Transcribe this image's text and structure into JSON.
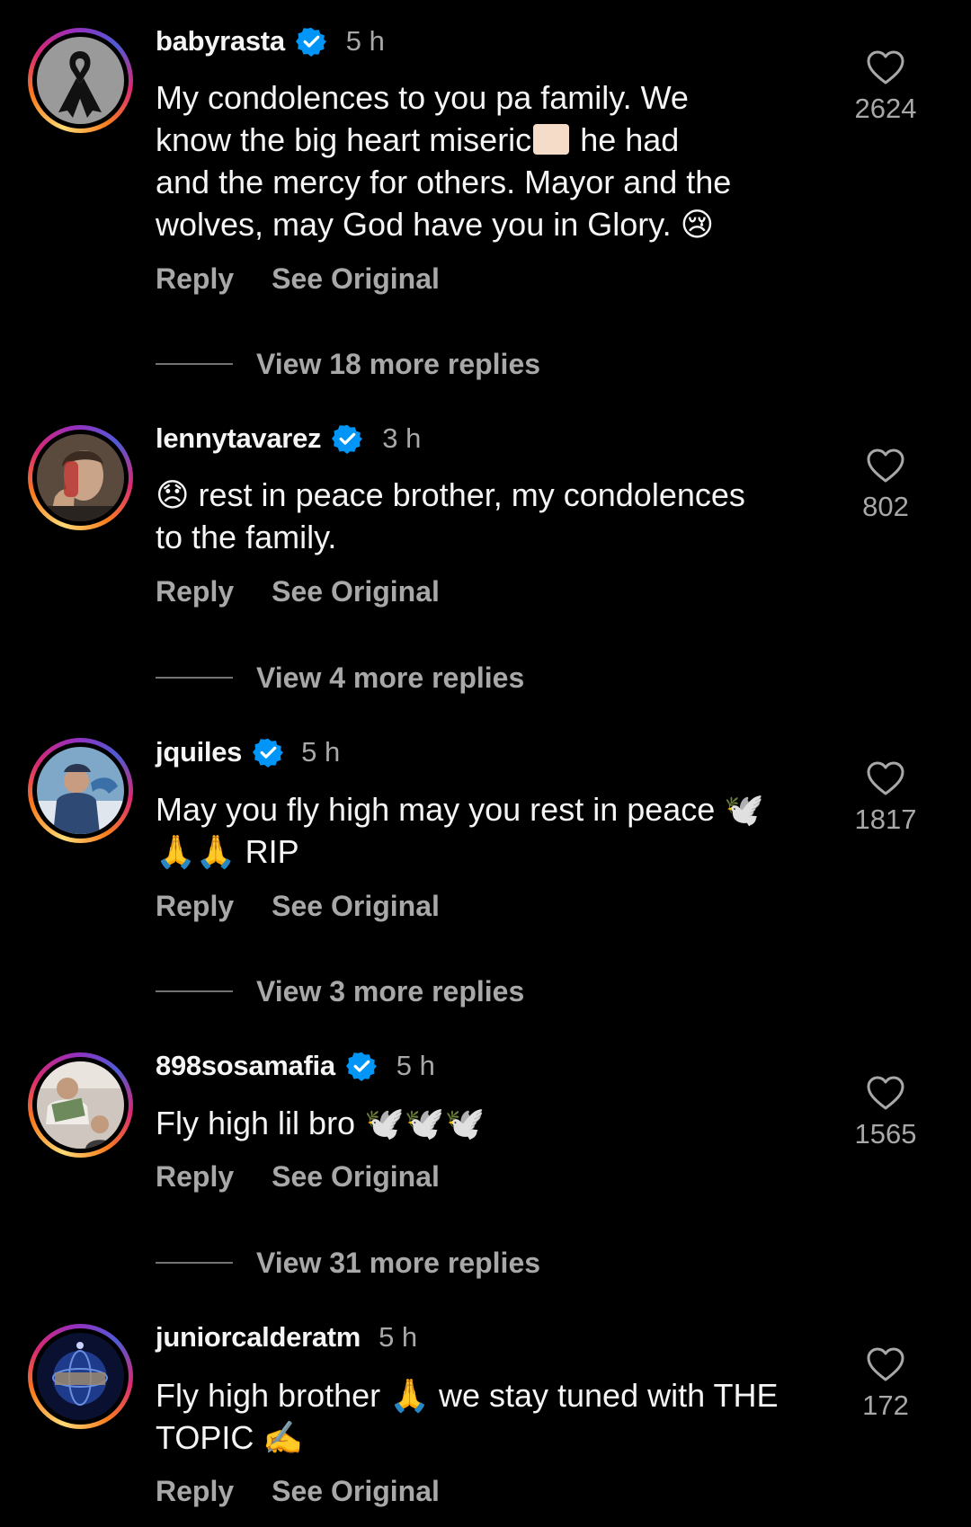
{
  "comments": [
    {
      "username": "babyrasta",
      "verified": true,
      "time": "5 h",
      "lines": [
        "My condolences to you pa family. We",
        "know the big heart miseric",
        "and the mercy for others. Mayor and the",
        "wolves, may God have you in Glory."
      ],
      "line2_after": " he had",
      "emoji_end": "😢",
      "likes": "2624",
      "reply_label": "Reply",
      "see_original_label": "See Original",
      "view_replies": "View 18 more replies",
      "avatar_icon": "black-ribbon-icon"
    },
    {
      "username": "lennytavarez",
      "verified": true,
      "time": "3 h",
      "emoji_start": "😞",
      "lines": [
        " rest in peace brother, my condolences",
        "to the family."
      ],
      "likes": "802",
      "reply_label": "Reply",
      "see_original_label": "See Original",
      "view_replies": "View 4 more replies",
      "avatar_icon": "portrait-photo"
    },
    {
      "username": "jquiles",
      "verified": true,
      "time": "5 h",
      "lines": [
        "May you fly high may you rest in peace ",
        " RIP"
      ],
      "emoji_dove": "🕊️",
      "emoji_pray": "🙏🙏",
      "likes": "1817",
      "reply_label": "Reply",
      "see_original_label": "See Original",
      "view_replies": "View 3 more replies",
      "avatar_icon": "portrait-photo"
    },
    {
      "username": "898sosamafia",
      "verified": true,
      "time": "5 h",
      "lines": [
        "Fly high lil bro "
      ],
      "emoji_doves": "🕊️🕊️🕊️",
      "likes": "1565",
      "reply_label": "Reply",
      "see_original_label": "See Original",
      "view_replies": "View 31 more replies",
      "avatar_icon": "portrait-photo"
    },
    {
      "username": "juniorcalderatm",
      "verified": false,
      "time": "5 h",
      "lines": [
        "Fly high brother ",
        " we stay tuned with THE",
        "TOPIC "
      ],
      "emoji_pray": "🙏",
      "emoji_write": "✍️",
      "likes": "172",
      "reply_label": "Reply",
      "see_original_label": "See Original",
      "avatar_icon": "globe-logo"
    }
  ],
  "colors": {
    "background": "#000000",
    "text_primary": "#f5f5f5",
    "text_secondary": "#a8a8a8",
    "verified_blue": "#0095f6"
  }
}
